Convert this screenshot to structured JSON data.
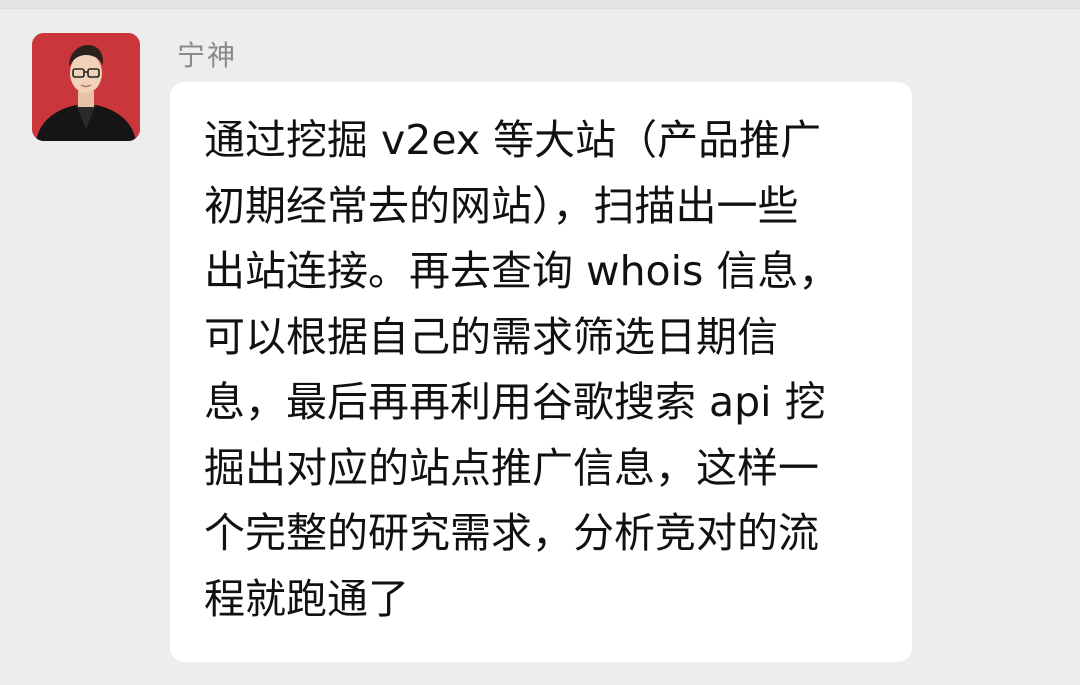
{
  "chat": {
    "message": {
      "sender": "宁神",
      "text": "通过挖掘 v2ex 等大站（产品推广\n初期经常去的网站），扫描出一些\n出站连接。再去查询 whois 信息，\n可以根据自己的需求筛选日期信\n息，最后再再利用谷歌搜索 api 挖\n掘出对应的站点推广信息，这样一\n个完整的研究需求，分析竞对的流\n程就跑通了"
    }
  },
  "colors": {
    "background": "#ededed",
    "bubble": "#ffffff",
    "sender_name": "#8a8a8a",
    "text": "#111111",
    "avatar_bg": "#c9363c"
  }
}
